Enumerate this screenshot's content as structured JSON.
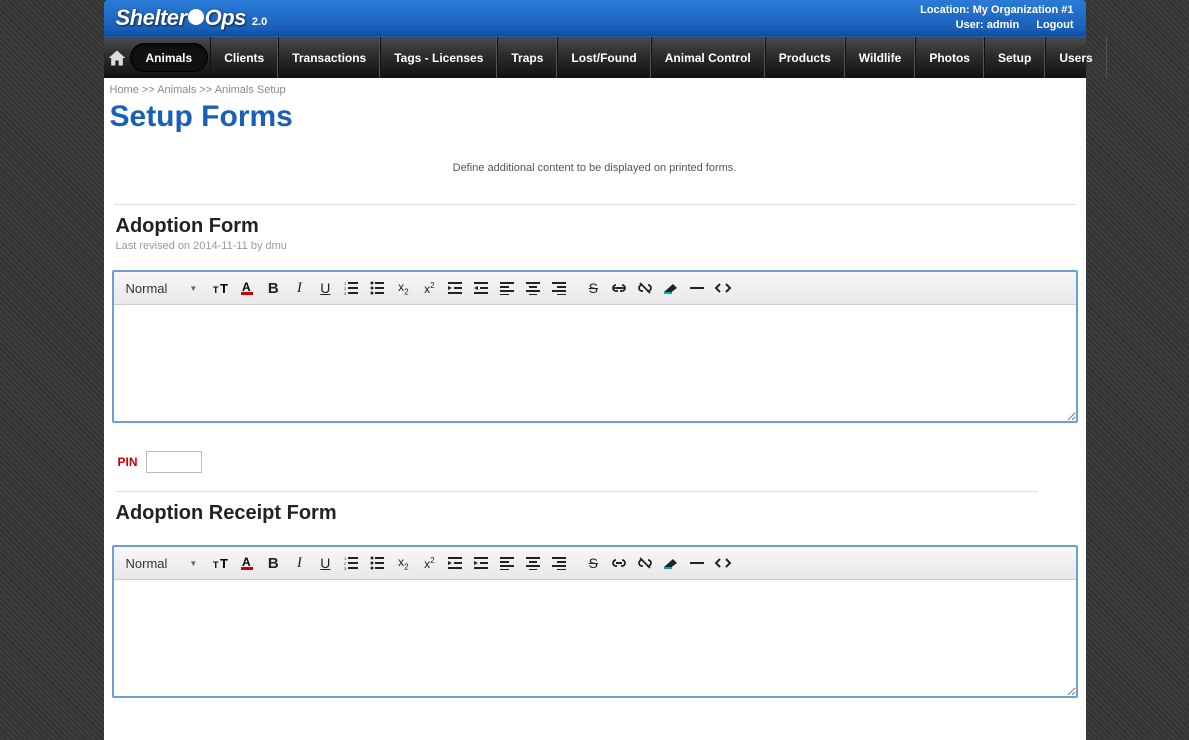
{
  "header": {
    "logo_pre": "Shelter",
    "logo_suf": "Ops",
    "version": "2.0",
    "location_label": "Location: My Organization #1",
    "user_label": "User: admin",
    "logout": "Logout"
  },
  "nav": {
    "items": [
      "Animals",
      "Clients",
      "Transactions",
      "Tags - Licenses",
      "Traps",
      "Lost/Found",
      "Animal Control",
      "Products",
      "Wildlife",
      "Photos",
      "Setup",
      "Users"
    ],
    "active_index": 0
  },
  "breadcrumb": {
    "parts": [
      "Home",
      "Animals",
      "Animals Setup"
    ],
    "sep": " >> "
  },
  "page": {
    "title": "Setup Forms",
    "description": "Define additional content to be displayed on printed forms."
  },
  "forms": [
    {
      "title": "Adoption Form",
      "revised": "Last revised on 2014-11-11 by dmu",
      "toolbar_format": "Normal"
    },
    {
      "title": "Adoption Receipt Form",
      "revised": "",
      "toolbar_format": "Normal"
    }
  ],
  "pin": {
    "label": "PIN",
    "value": ""
  },
  "toolbar_icons": [
    "font-size",
    "text-color",
    "bold",
    "italic",
    "underline",
    "ordered-list",
    "unordered-list",
    "subscript",
    "superscript",
    "outdent",
    "indent",
    "align-left",
    "align-center",
    "align-right",
    "strikethrough",
    "link",
    "unlink",
    "remove-format",
    "horizontal-rule",
    "code-view"
  ]
}
